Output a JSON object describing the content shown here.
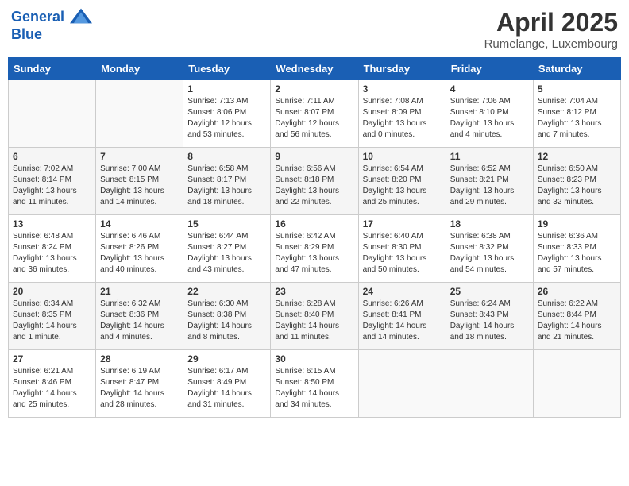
{
  "header": {
    "logo_line1": "General",
    "logo_line2": "Blue",
    "main_title": "April 2025",
    "subtitle": "Rumelange, Luxembourg"
  },
  "days_of_week": [
    "Sunday",
    "Monday",
    "Tuesday",
    "Wednesday",
    "Thursday",
    "Friday",
    "Saturday"
  ],
  "weeks": [
    [
      {
        "day": "",
        "info": ""
      },
      {
        "day": "",
        "info": ""
      },
      {
        "day": "1",
        "info": "Sunrise: 7:13 AM\nSunset: 8:06 PM\nDaylight: 12 hours and 53 minutes."
      },
      {
        "day": "2",
        "info": "Sunrise: 7:11 AM\nSunset: 8:07 PM\nDaylight: 12 hours and 56 minutes."
      },
      {
        "day": "3",
        "info": "Sunrise: 7:08 AM\nSunset: 8:09 PM\nDaylight: 13 hours and 0 minutes."
      },
      {
        "day": "4",
        "info": "Sunrise: 7:06 AM\nSunset: 8:10 PM\nDaylight: 13 hours and 4 minutes."
      },
      {
        "day": "5",
        "info": "Sunrise: 7:04 AM\nSunset: 8:12 PM\nDaylight: 13 hours and 7 minutes."
      }
    ],
    [
      {
        "day": "6",
        "info": "Sunrise: 7:02 AM\nSunset: 8:14 PM\nDaylight: 13 hours and 11 minutes."
      },
      {
        "day": "7",
        "info": "Sunrise: 7:00 AM\nSunset: 8:15 PM\nDaylight: 13 hours and 14 minutes."
      },
      {
        "day": "8",
        "info": "Sunrise: 6:58 AM\nSunset: 8:17 PM\nDaylight: 13 hours and 18 minutes."
      },
      {
        "day": "9",
        "info": "Sunrise: 6:56 AM\nSunset: 8:18 PM\nDaylight: 13 hours and 22 minutes."
      },
      {
        "day": "10",
        "info": "Sunrise: 6:54 AM\nSunset: 8:20 PM\nDaylight: 13 hours and 25 minutes."
      },
      {
        "day": "11",
        "info": "Sunrise: 6:52 AM\nSunset: 8:21 PM\nDaylight: 13 hours and 29 minutes."
      },
      {
        "day": "12",
        "info": "Sunrise: 6:50 AM\nSunset: 8:23 PM\nDaylight: 13 hours and 32 minutes."
      }
    ],
    [
      {
        "day": "13",
        "info": "Sunrise: 6:48 AM\nSunset: 8:24 PM\nDaylight: 13 hours and 36 minutes."
      },
      {
        "day": "14",
        "info": "Sunrise: 6:46 AM\nSunset: 8:26 PM\nDaylight: 13 hours and 40 minutes."
      },
      {
        "day": "15",
        "info": "Sunrise: 6:44 AM\nSunset: 8:27 PM\nDaylight: 13 hours and 43 minutes."
      },
      {
        "day": "16",
        "info": "Sunrise: 6:42 AM\nSunset: 8:29 PM\nDaylight: 13 hours and 47 minutes."
      },
      {
        "day": "17",
        "info": "Sunrise: 6:40 AM\nSunset: 8:30 PM\nDaylight: 13 hours and 50 minutes."
      },
      {
        "day": "18",
        "info": "Sunrise: 6:38 AM\nSunset: 8:32 PM\nDaylight: 13 hours and 54 minutes."
      },
      {
        "day": "19",
        "info": "Sunrise: 6:36 AM\nSunset: 8:33 PM\nDaylight: 13 hours and 57 minutes."
      }
    ],
    [
      {
        "day": "20",
        "info": "Sunrise: 6:34 AM\nSunset: 8:35 PM\nDaylight: 14 hours and 1 minute."
      },
      {
        "day": "21",
        "info": "Sunrise: 6:32 AM\nSunset: 8:36 PM\nDaylight: 14 hours and 4 minutes."
      },
      {
        "day": "22",
        "info": "Sunrise: 6:30 AM\nSunset: 8:38 PM\nDaylight: 14 hours and 8 minutes."
      },
      {
        "day": "23",
        "info": "Sunrise: 6:28 AM\nSunset: 8:40 PM\nDaylight: 14 hours and 11 minutes."
      },
      {
        "day": "24",
        "info": "Sunrise: 6:26 AM\nSunset: 8:41 PM\nDaylight: 14 hours and 14 minutes."
      },
      {
        "day": "25",
        "info": "Sunrise: 6:24 AM\nSunset: 8:43 PM\nDaylight: 14 hours and 18 minutes."
      },
      {
        "day": "26",
        "info": "Sunrise: 6:22 AM\nSunset: 8:44 PM\nDaylight: 14 hours and 21 minutes."
      }
    ],
    [
      {
        "day": "27",
        "info": "Sunrise: 6:21 AM\nSunset: 8:46 PM\nDaylight: 14 hours and 25 minutes."
      },
      {
        "day": "28",
        "info": "Sunrise: 6:19 AM\nSunset: 8:47 PM\nDaylight: 14 hours and 28 minutes."
      },
      {
        "day": "29",
        "info": "Sunrise: 6:17 AM\nSunset: 8:49 PM\nDaylight: 14 hours and 31 minutes."
      },
      {
        "day": "30",
        "info": "Sunrise: 6:15 AM\nSunset: 8:50 PM\nDaylight: 14 hours and 34 minutes."
      },
      {
        "day": "",
        "info": ""
      },
      {
        "day": "",
        "info": ""
      },
      {
        "day": "",
        "info": ""
      }
    ]
  ]
}
